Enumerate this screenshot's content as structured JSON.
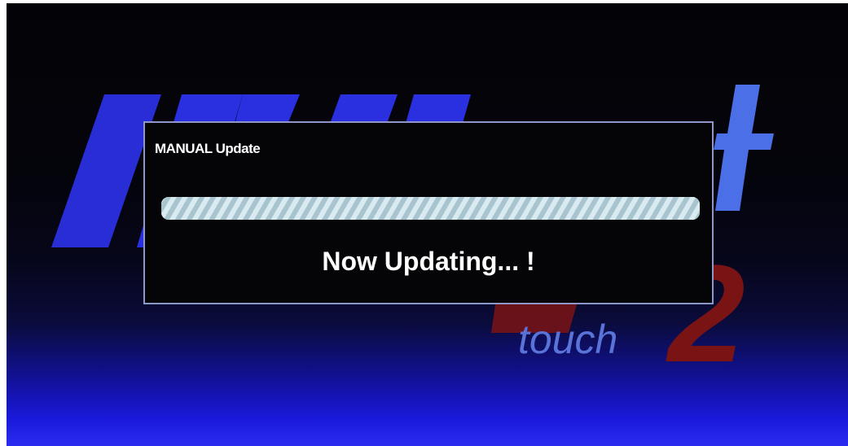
{
  "dialog": {
    "title": "MANUAL Update",
    "status": "Now Updating... !",
    "progress_fraction": 1.0
  },
  "background": {
    "logo_word": "touch",
    "logo_numeral": "2"
  },
  "colors": {
    "logo_blue": "#2a2fe0",
    "logo_red": "#7a1414",
    "dialog_border": "#8f97c9",
    "progress_stripe_light": "#d9ebf0",
    "progress_stripe_dark": "#a7c4cf"
  },
  "icons": [
    "brand-logo"
  ]
}
